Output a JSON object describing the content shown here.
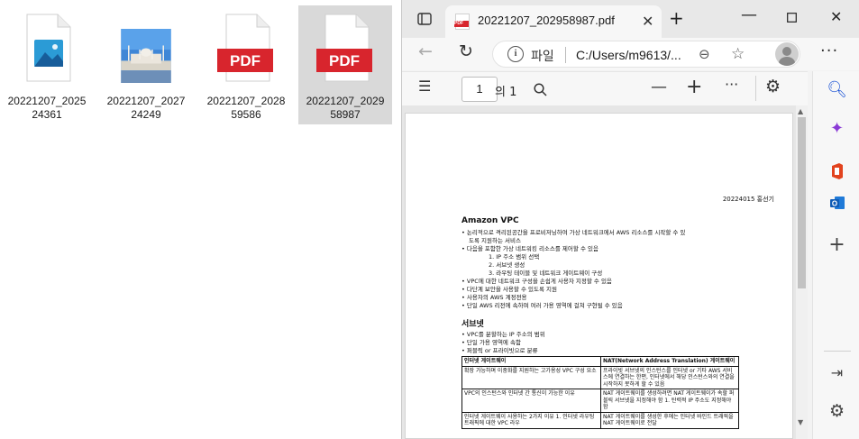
{
  "desktop": {
    "files": [
      {
        "name": "20221207_202524361",
        "type": "image-generic",
        "selected": false
      },
      {
        "name": "20221207_202724249",
        "type": "photo",
        "selected": false
      },
      {
        "name": "20221207_202859586",
        "type": "pdf",
        "badge": "PDF",
        "selected": false
      },
      {
        "name": "20221207_202958987",
        "type": "pdf",
        "badge": "PDF",
        "selected": true
      }
    ]
  },
  "browser": {
    "tab_title": "20221207_202958987.pdf",
    "tab_icon_text": "PDF",
    "address": {
      "scheme_label": "파일",
      "url": "C:/Users/m9613/..."
    },
    "pdf_toolbar": {
      "page_number": "1",
      "page_count_label": "의 1"
    }
  },
  "document": {
    "date_line": "20224015 홍선기",
    "sections": [
      {
        "heading": "Amazon VPC",
        "lines": [
          {
            "bullet": "•",
            "text": "논리적으로 격리된공간을 프로비저닝하여 가상 네트워크에서 AWS 리소스를 시작할 수 있"
          },
          {
            "bullet": "",
            "text": "도록 지원하는 서비스"
          },
          {
            "bullet": "•",
            "text": "다음을 포함한 가상 네트워킹 리소스를 제어할 수 있음"
          },
          {
            "bullet": "",
            "text": "1. IP 주소 범위 선택"
          },
          {
            "bullet": "",
            "text": "2. 서브넷 생성"
          },
          {
            "bullet": "",
            "text": "3. 라우팅 테이블 및 네트워크 게이트웨이 구성"
          },
          {
            "bullet": "•",
            "text": "VPC에 대한 네트워크 구성을 손쉽게 사용자 지정할 수 있음"
          },
          {
            "bullet": "•",
            "text": "다단계 보안을 사용할 수 있도록 지원"
          },
          {
            "bullet": "•",
            "text": "사용자의 AWS 계정전용"
          },
          {
            "bullet": "•",
            "text": "단일 AWS 리전에 속하며 여러 가용 영역에 걸쳐 구현될 수 있음"
          }
        ]
      },
      {
        "heading": "서브넷",
        "lines": [
          {
            "bullet": "•",
            "text": "VPC를 분할하는 IP 주소의 범위"
          },
          {
            "bullet": "•",
            "text": "단일 가용 영역에 속함"
          },
          {
            "bullet": "•",
            "text": "퍼블릭 or 프라이빗으로 분류"
          }
        ]
      }
    ],
    "table": {
      "headers": [
        "인터넷 게이트웨이",
        "NAT(Network Address Translation) 게이트웨이"
      ],
      "rows": [
        [
          "확장 가능하며 이중화를 지원하는 고가용성 VPC 구성 요소",
          "프라이빗 서브넷의 인스턴스를 인터넷 or 기타 AWS 서비스에 연결하는 한편, 인터넷에서 해당 인스턴스와의 연결을 시작하지 못하게 할 수 있음"
        ],
        [
          "VPC의 인스턴스와 인터넷 간 통신이 가능한 이유",
          "NAT 게이트웨이를 생성하려면 NAT 게이트웨이가 속할 퍼블릭 서브넷을 지정해야 함 1. 탄력적 IP 주소도 지정해야 함"
        ],
        [
          "인터넷 게이트웨이 사용하는 2가지 이유 1. 인터넷 라우팅 트래픽에 대한 VPC 라우",
          "NAT 게이트웨이를 생성한 후에는 인터넷 바인드 트래픽을 NAT 게이트웨이로 전달"
        ]
      ]
    }
  }
}
